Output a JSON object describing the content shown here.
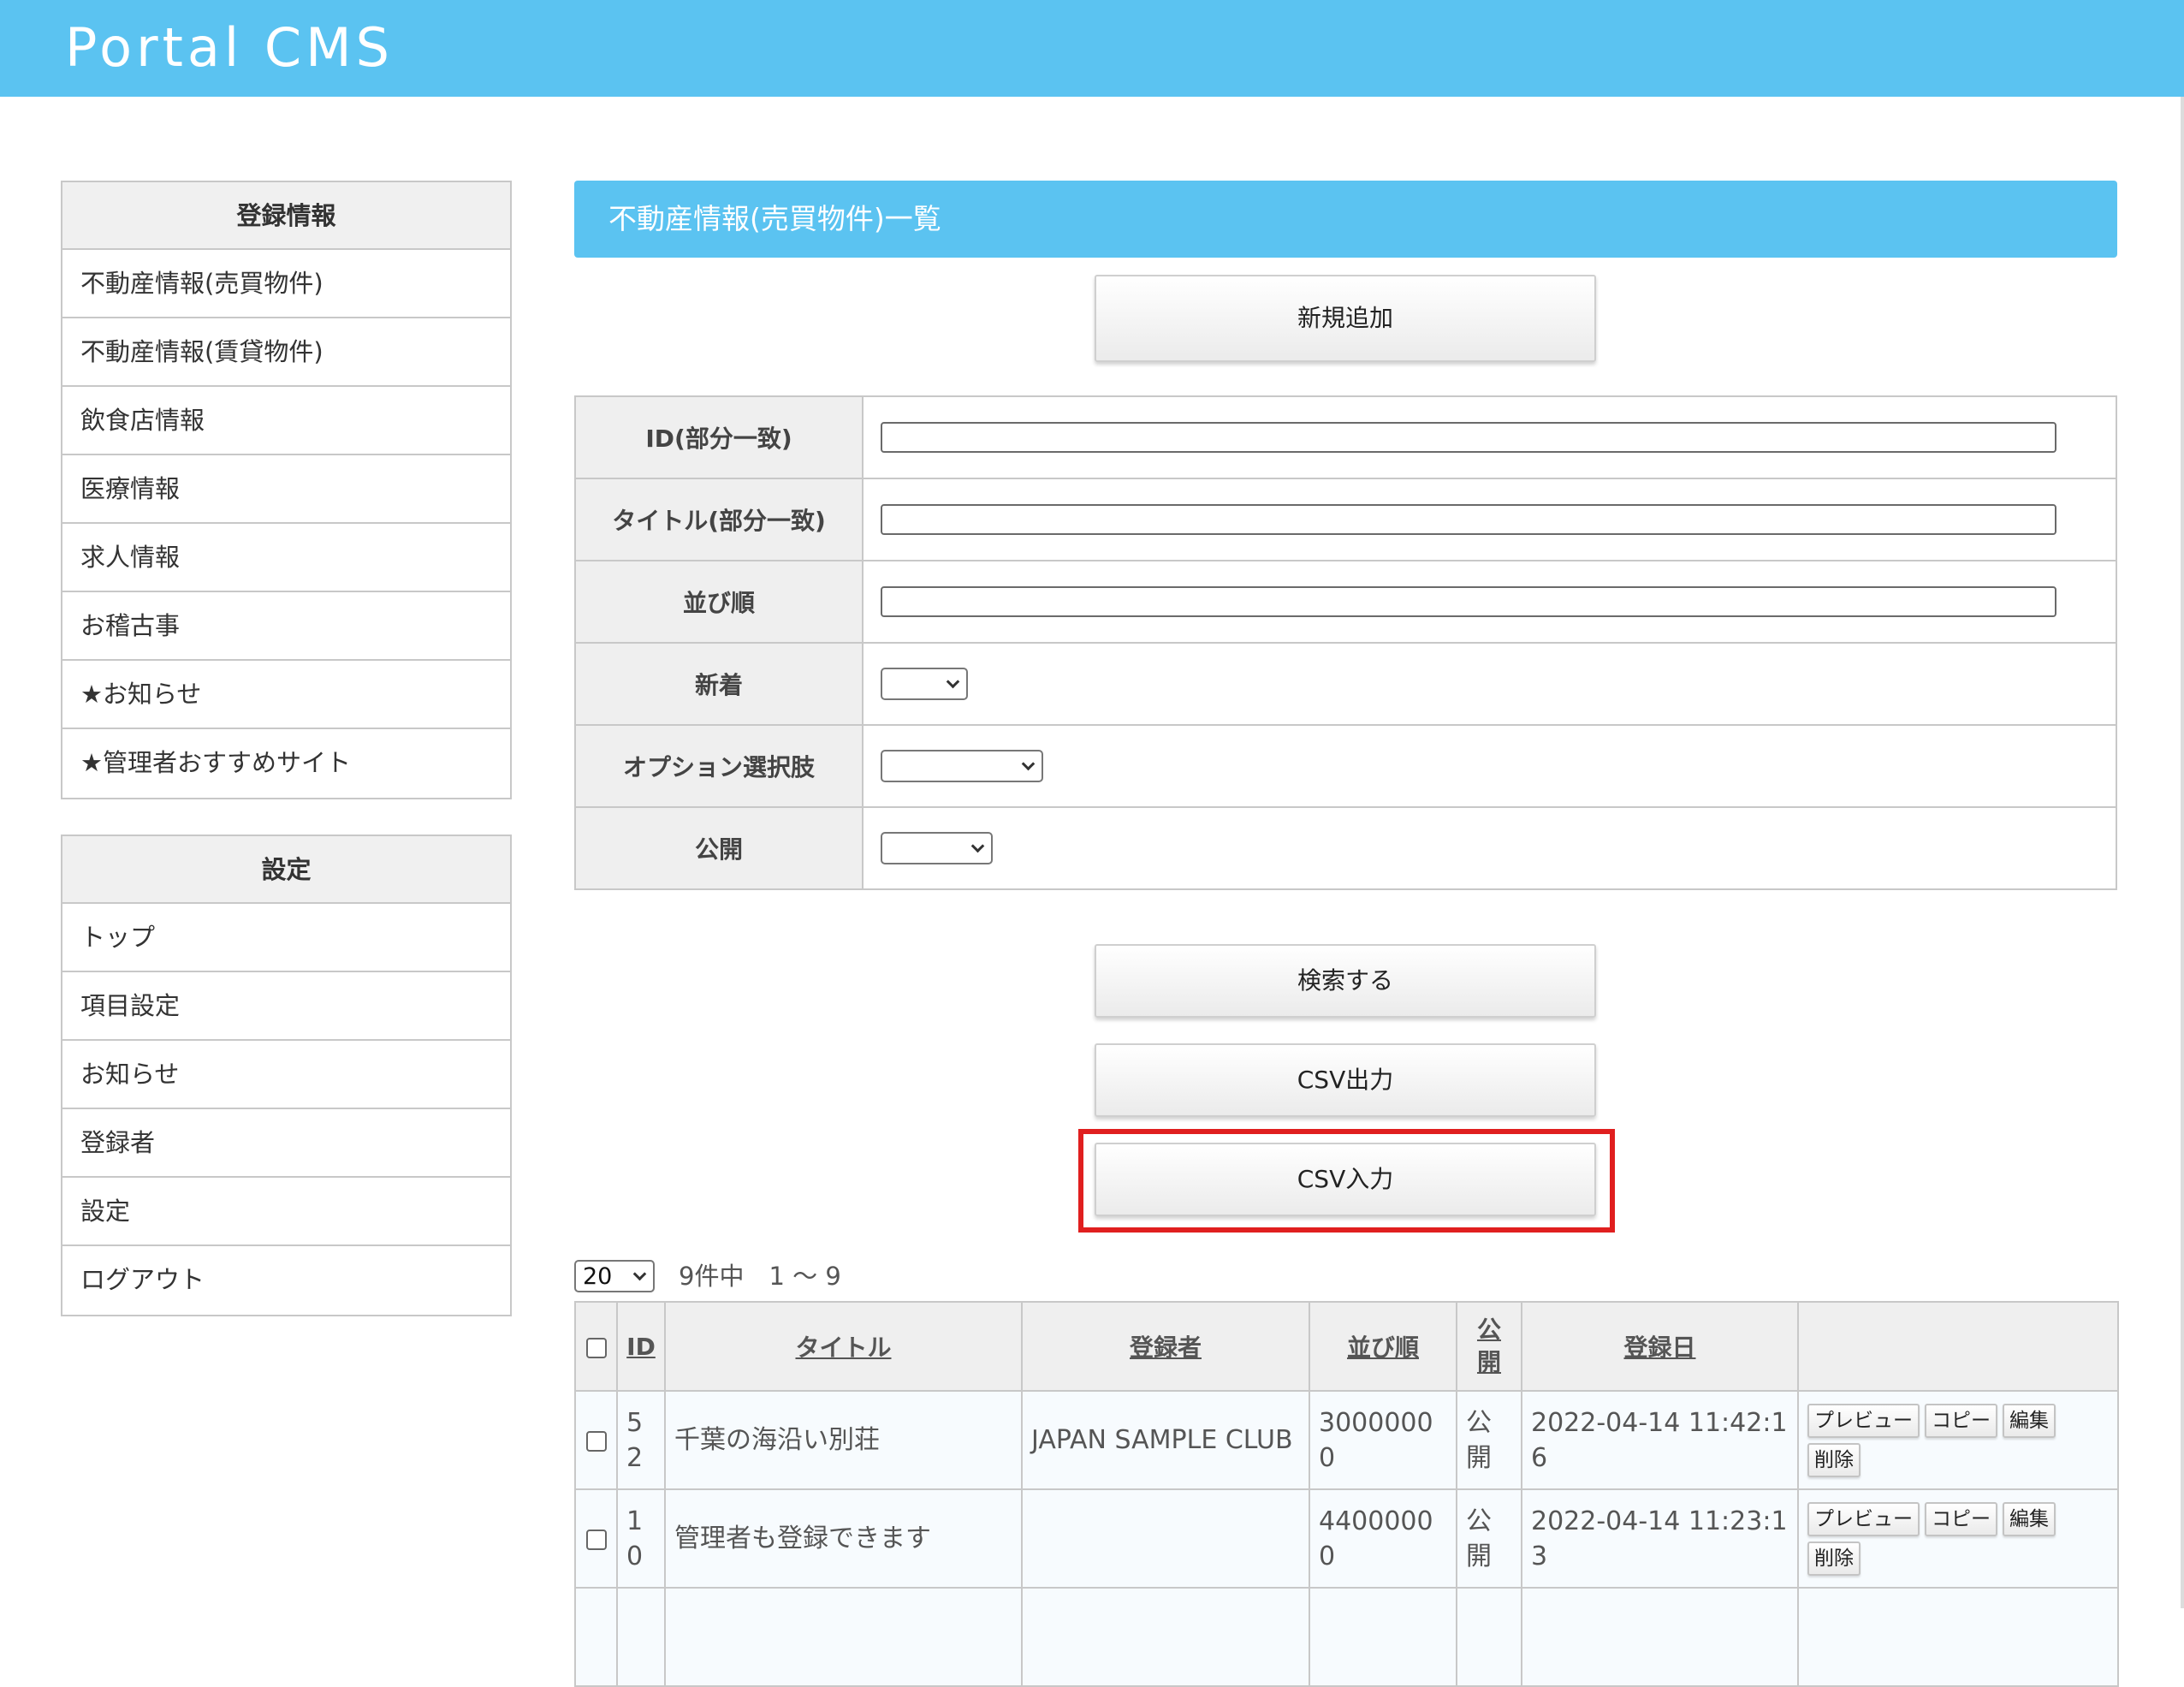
{
  "header": {
    "app_title": "Portal CMS"
  },
  "sidebar": {
    "registration": {
      "heading": "登録情報",
      "items": [
        "不動産情報(売買物件)",
        "不動産情報(賃貸物件)",
        "飲食店情報",
        "医療情報",
        "求人情報",
        "お稽古事",
        "★お知らせ",
        "★管理者おすすめサイト"
      ]
    },
    "settings": {
      "heading": "設定",
      "items": [
        "トップ",
        "項目設定",
        "お知らせ",
        "登録者",
        "設定",
        "ログアウト"
      ]
    }
  },
  "main": {
    "page_title": "不動産情報(売買物件)一覧",
    "add_button": "新規追加",
    "search_form": {
      "id_label": "ID(部分一致)",
      "title_label": "タイトル(部分一致)",
      "order_label": "並び順",
      "new_label": "新着",
      "option_label": "オプション選択肢",
      "public_label": "公開"
    },
    "search_button": "検索する",
    "csv_export_button": "CSV出力",
    "csv_import_button": "CSV入力",
    "per_page_value": "20",
    "result_summary": "9件中　1 〜 9",
    "table": {
      "headers": {
        "id": "ID",
        "title": "タイトル",
        "registrant": "登録者",
        "order": "並び順",
        "public": "公開",
        "date": "登録日"
      },
      "actions": {
        "preview": "プレビュー",
        "copy": "コピー",
        "edit": "編集",
        "delete": "削除"
      },
      "rows": [
        {
          "id": "52",
          "title": "千葉の海沿い別荘",
          "registrant": "JAPAN SAMPLE CLUB",
          "order": "30000000",
          "public": "公開",
          "date": "2022-04-14 11:42:16"
        },
        {
          "id": "10",
          "title": "管理者も登録できます",
          "registrant": "",
          "order": "44000000",
          "public": "公開",
          "date": "2022-04-14 11:23:13"
        }
      ]
    }
  }
}
